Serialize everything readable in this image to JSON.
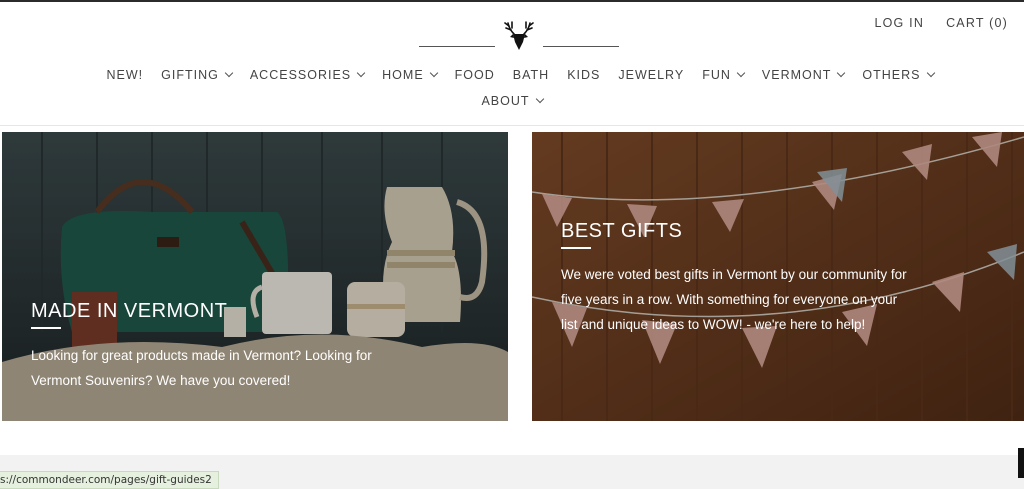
{
  "header": {
    "log_in": "LOG IN",
    "cart": "CART (0)"
  },
  "nav": {
    "row1": [
      {
        "label": "NEW!",
        "dropdown": false
      },
      {
        "label": "GIFTING",
        "dropdown": true
      },
      {
        "label": "ACCESSORIES",
        "dropdown": true
      },
      {
        "label": "HOME",
        "dropdown": true
      },
      {
        "label": "FOOD",
        "dropdown": false
      },
      {
        "label": "BATH",
        "dropdown": false
      },
      {
        "label": "KIDS",
        "dropdown": false
      },
      {
        "label": "JEWELRY",
        "dropdown": false
      },
      {
        "label": "FUN",
        "dropdown": true
      },
      {
        "label": "VERMONT",
        "dropdown": true
      },
      {
        "label": "OTHERS",
        "dropdown": true
      }
    ],
    "row2": [
      {
        "label": "ABOUT",
        "dropdown": true
      }
    ]
  },
  "banners": {
    "left": {
      "title": "MADE IN VERMONT",
      "description": "Looking for great products made in Vermont? Looking for Vermont Souvenirs? We have you covered!"
    },
    "right": {
      "title": "BEST GIFTS",
      "description": "We were voted best gifts in Vermont by our community for five years in a row. With something for everyone on your list and unique ideas to WOW! - we're here to help!"
    }
  },
  "status": {
    "url": "s://commondeer.com/pages/gift-guides2"
  },
  "colors": {
    "left_banner_bg": "#2f3a3c",
    "right_banner_bg": "#6b3d22",
    "nav_text": "#444444"
  }
}
